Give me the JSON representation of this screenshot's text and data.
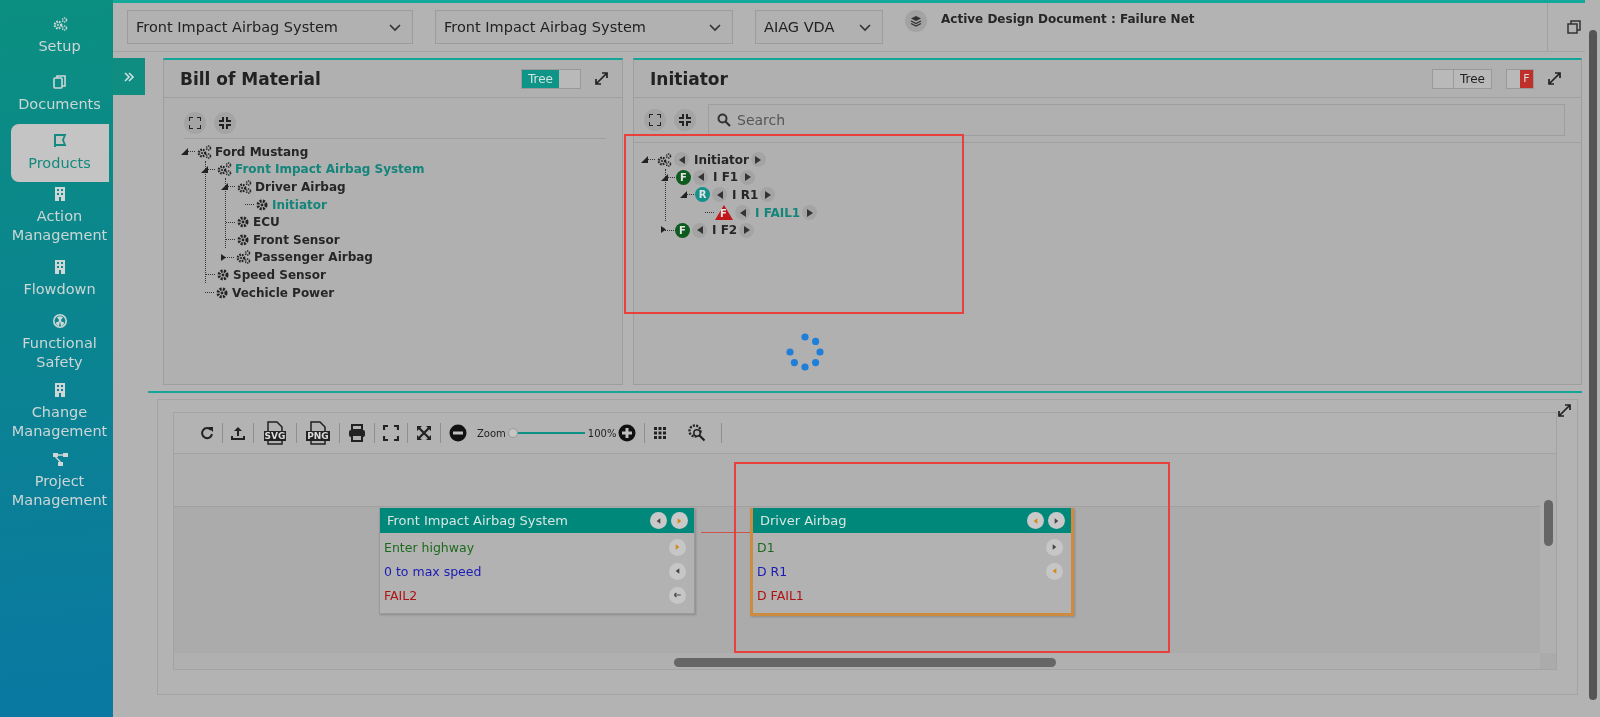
{
  "sidebar": {
    "items": [
      {
        "label": "Setup",
        "selected": false
      },
      {
        "label": "Documents",
        "selected": false
      },
      {
        "label": "Products",
        "selected": true
      },
      {
        "label": "Action Management",
        "selected": false
      },
      {
        "label": "Flowdown",
        "selected": false
      },
      {
        "label": "Functional Safety",
        "selected": false
      },
      {
        "label": "Change Management",
        "selected": false
      },
      {
        "label": "Project Management",
        "selected": false
      }
    ]
  },
  "top_bar": {
    "selects": [
      {
        "value": "Front Impact Airbag System"
      },
      {
        "value": "Front Impact Airbag System"
      },
      {
        "value": "AIAG VDA"
      }
    ],
    "active_document": "Active Design Document : Failure Net"
  },
  "bom": {
    "title": "Bill of Material",
    "toggle": {
      "label": "Tree",
      "on": true
    },
    "tree": [
      {
        "label": "Ford Mustang",
        "kind": "assembly",
        "selected": false,
        "expanded": true,
        "children": [
          {
            "label": "Front Impact Airbag System",
            "kind": "assembly",
            "selected": true,
            "expanded": true,
            "children": [
              {
                "label": "Driver Airbag",
                "kind": "assembly",
                "selected": false,
                "expanded": true,
                "children": [
                  {
                    "label": "Initiator",
                    "kind": "part",
                    "selected": true
                  }
                ]
              },
              {
                "label": "ECU",
                "kind": "part",
                "selected": false
              },
              {
                "label": "Front Sensor",
                "kind": "part",
                "selected": false
              },
              {
                "label": "Passenger Airbag",
                "kind": "assembly",
                "selected": false,
                "expanded": false
              }
            ]
          },
          {
            "label": "Speed Sensor",
            "kind": "part",
            "selected": false
          },
          {
            "label": "Vechicle Power",
            "kind": "part",
            "selected": false
          }
        ]
      }
    ]
  },
  "initiator": {
    "title": "Initiator",
    "toggle": {
      "label": "Tree",
      "on": false
    },
    "flag_toggle": {
      "label": "F",
      "on": true
    },
    "search": {
      "placeholder": "Search"
    },
    "tree": [
      {
        "label": "Initiator",
        "kind": "assembly",
        "selected": false,
        "expanded": true,
        "children": [
          {
            "label": "I F1",
            "kind": "function",
            "badge": "F",
            "selected": false,
            "expanded": true,
            "children": [
              {
                "label": "I R1",
                "kind": "requirement",
                "badge": "R",
                "selected": false,
                "expanded": true,
                "children": [
                  {
                    "label": "I FAIL1",
                    "kind": "failure",
                    "badge": "F",
                    "selected": true
                  }
                ]
              }
            ]
          },
          {
            "label": "I F2",
            "kind": "function",
            "badge": "F",
            "selected": false,
            "expanded": false
          }
        ]
      }
    ]
  },
  "diagram": {
    "toolbar": {
      "file_labels": [
        "SVG",
        "PNG"
      ],
      "zoom_label": "Zoom",
      "zoom_slider": {
        "level": 0.05
      },
      "zoom_reading": "100%"
    },
    "nodes": [
      {
        "title": "Front Impact Airbag System",
        "selected": false,
        "header_ports": [
          {
            "kind": "previous",
            "active": false
          },
          {
            "kind": "next",
            "active": true
          }
        ],
        "rows": [
          {
            "text": "Enter highway",
            "kind": "function",
            "port": {
              "kind": "next",
              "active": true
            }
          },
          {
            "text": "0 to max speed",
            "kind": "requirement",
            "port": {
              "kind": "previous",
              "active": false
            }
          },
          {
            "text": "FAIL2",
            "kind": "failure",
            "port": {
              "kind": "back",
              "active": false
            }
          }
        ]
      },
      {
        "title": "Driver Airbag",
        "selected": true,
        "header_ports": [
          {
            "kind": "previous",
            "active": true
          },
          {
            "kind": "next",
            "active": false
          }
        ],
        "rows": [
          {
            "text": "D1",
            "kind": "function",
            "port": {
              "kind": "next",
              "active": false
            }
          },
          {
            "text": "D R1",
            "kind": "requirement",
            "port": {
              "kind": "previous",
              "active": true
            }
          },
          {
            "text": "D FAIL1",
            "kind": "failure"
          }
        ]
      }
    ]
  }
}
